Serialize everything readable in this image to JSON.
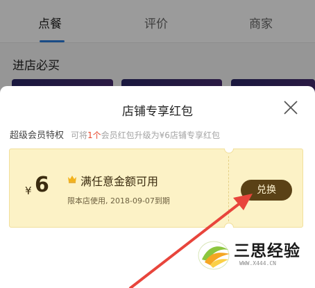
{
  "tabs": [
    {
      "label": "点餐",
      "active": true
    },
    {
      "label": "评价",
      "active": false
    },
    {
      "label": "商家",
      "active": false
    }
  ],
  "section_title": "进店必买",
  "modal": {
    "title": "店铺专享红包",
    "privilege_label": "超级会员特权",
    "privilege_desc_prefix": "可将",
    "privilege_count": "1个",
    "privilege_desc_suffix": "会员红包升级为¥6店铺专享红包"
  },
  "coupon": {
    "currency": "¥",
    "amount": "6",
    "title": "满任意金额可用",
    "subtitle": "限本店使用, 2018-09-07到期",
    "button_label": "兑换"
  },
  "watermark": {
    "text": "三思经验",
    "url": "WWW.X444.CN"
  },
  "colors": {
    "accent": "#2a7bd8",
    "highlight": "#e8452a",
    "coupon_bg": "#fcf2c6",
    "button_bg": "#5a4116",
    "arrow": "#e8453c"
  }
}
